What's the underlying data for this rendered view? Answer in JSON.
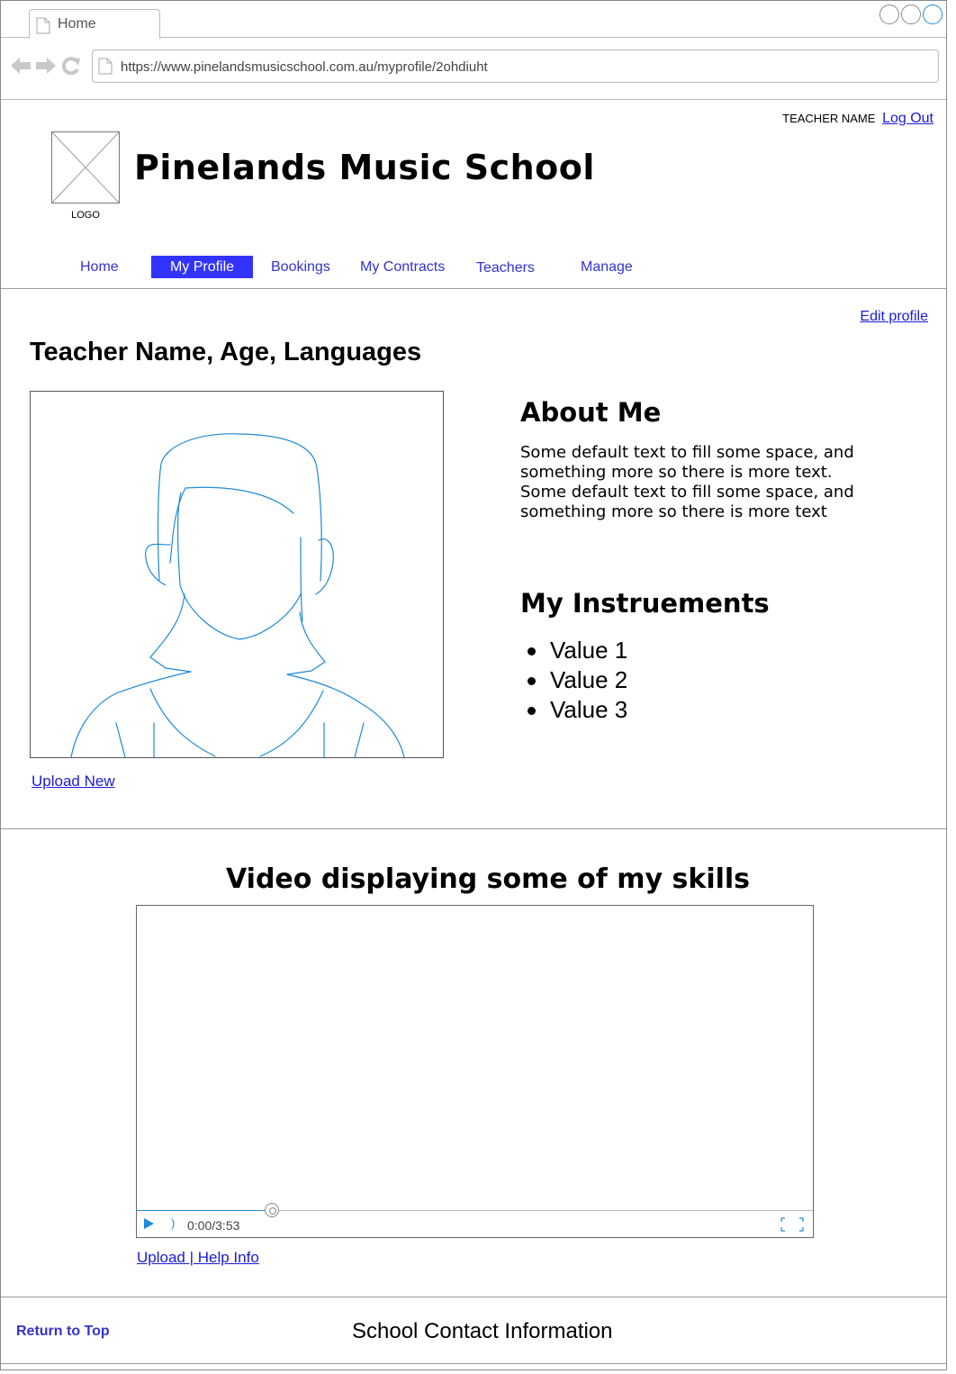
{
  "browser": {
    "tab_title": "Home",
    "url": "https://www.pinelandsmusicschool.com.au/myprofile/2ohdiuht"
  },
  "header": {
    "user_label": "TEACHER NAME",
    "logout_label": "Log Out",
    "logo_label": "LOGO",
    "site_title": "Pinelands Music School"
  },
  "nav": {
    "items": [
      {
        "label": "Home"
      },
      {
        "label": "My Profile",
        "active": true
      },
      {
        "label": "Bookings"
      },
      {
        "label": "My Contracts"
      },
      {
        "label": "Teachers"
      },
      {
        "label": "Manage"
      }
    ]
  },
  "profile": {
    "edit_label": "Edit profile",
    "heading": "Teacher Name, Age, Languages",
    "upload_label": "Upload New",
    "about_heading": "About Me",
    "about_text": "Some default text to fill some space, and something more so there is more text. Some default text to fill some space, and something more so there is more text",
    "instruments_heading": "My Instruements",
    "instruments": [
      "Value 1",
      "Value 2",
      "Value 3"
    ]
  },
  "video": {
    "heading": "Video displaying some of my skills",
    "time": "0:00/3:53",
    "progress": 0.2,
    "links_label": "Upload | Help Info"
  },
  "footer": {
    "return_label": "Return to Top",
    "contact_label": "School Contact Information"
  },
  "colors": {
    "nav_active": "#3333ff",
    "link": "#1b1bd6",
    "media_accent": "#1e8ad6"
  }
}
